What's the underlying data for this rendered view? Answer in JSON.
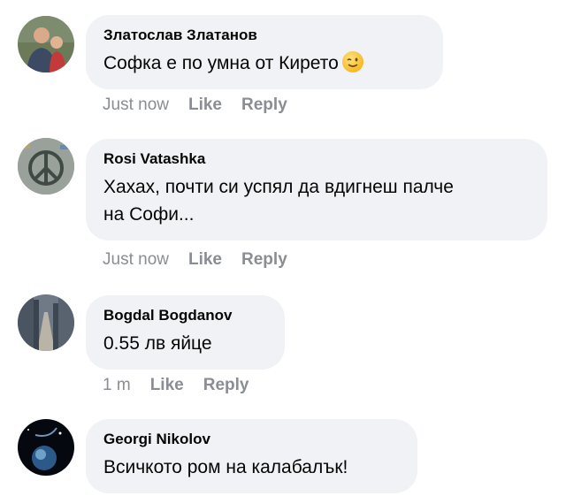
{
  "comments": [
    {
      "author": "Златослав Златанов",
      "text": "Софка е по умна от Кирето",
      "emoji": "winking-face-emoji",
      "timestamp": "Just now",
      "like_label": "Like",
      "reply_label": "Reply"
    },
    {
      "author": "Rosi Vatashka",
      "text_line1": "Хахах, почти си успял да вдигнеш палче",
      "text_line2": "на Софи...",
      "timestamp": "Just now",
      "like_label": "Like",
      "reply_label": "Reply"
    },
    {
      "author": "Bogdal Bogdanov",
      "text": "0.55 лв яйце",
      "timestamp": "1 m",
      "like_label": "Like",
      "reply_label": "Reply"
    },
    {
      "author": "Georgi Nikolov",
      "text": "Всичкото ром на калабалък!"
    }
  ],
  "colors": {
    "bubble": "#f0f2f5",
    "text": "#050505",
    "meta": "#8a8d91"
  }
}
